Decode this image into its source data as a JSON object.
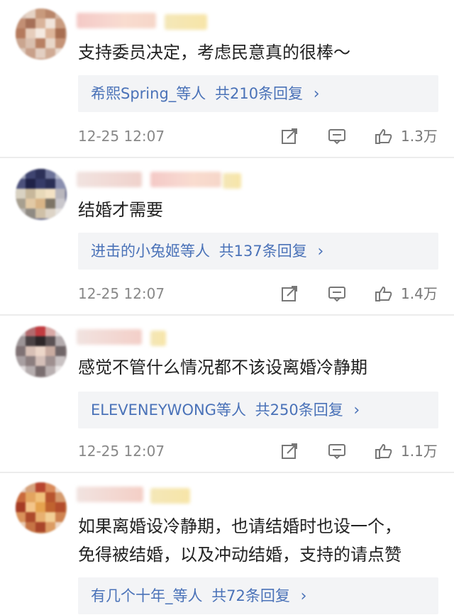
{
  "comments": [
    {
      "text": "支持委员决定，考虑民意真的很棒～",
      "reply_users": "希熙Spring_等人",
      "reply_count": "共210条回复",
      "time": "12-25 12:07",
      "likes": "1.3万"
    },
    {
      "text": "结婚才需要",
      "reply_users": "进击的小兔姬等人",
      "reply_count": "共137条回复",
      "time": "12-25 12:07",
      "likes": "1.4万"
    },
    {
      "text": "感觉不管什么情况都不该设离婚冷静期",
      "reply_users": "ELEVENEYWONG等人",
      "reply_count": "共250条回复",
      "time": "12-25 12:07",
      "likes": "1.1万"
    },
    {
      "text_line1": "如果离婚设冷静期，也请结婚时也设一个，",
      "text_line2": "免得被结婚，以及冲动结婚，支持的请点赞",
      "reply_users": "有几个十年_等人",
      "reply_count": "共72条回复"
    }
  ],
  "icons": {
    "share": "share-icon",
    "comment": "comment-icon",
    "like": "thumbs-up-icon",
    "reply_arrow": "chevron-right-icon"
  },
  "colors": {
    "link": "#4a72b8",
    "reply_bg": "#f3f4f6",
    "meta": "#888888"
  }
}
